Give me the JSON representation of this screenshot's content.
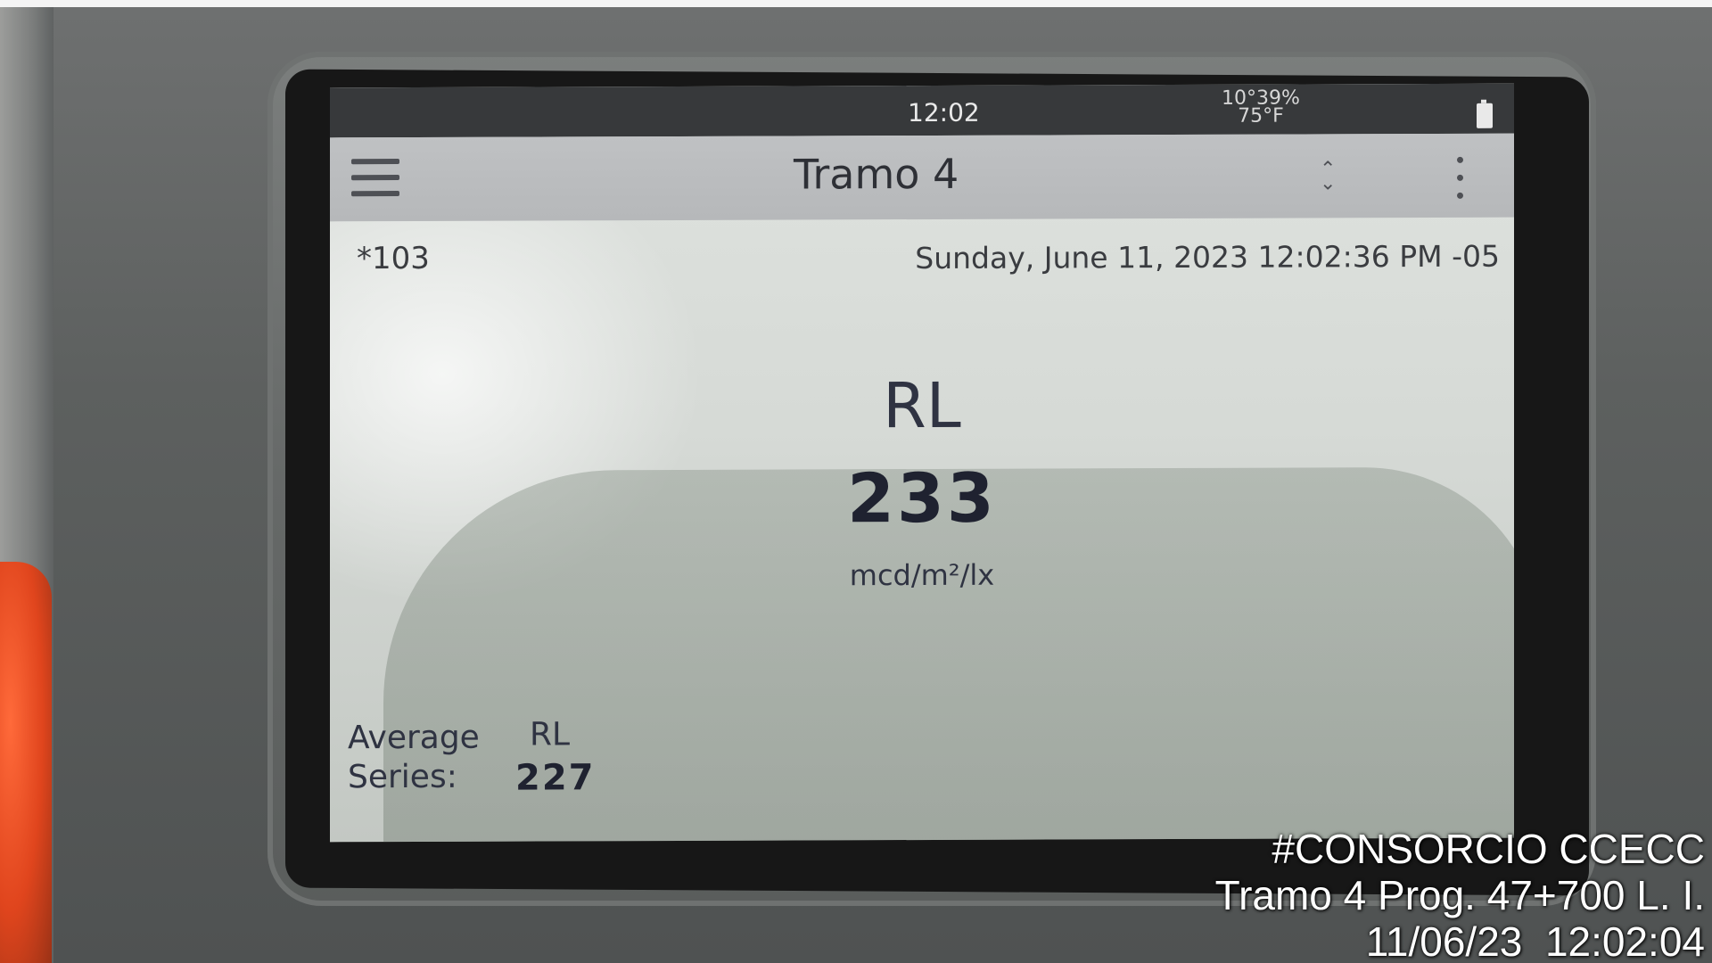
{
  "status_bar": {
    "time": "12:02",
    "environment": "10°39%\n75°F"
  },
  "toolbar": {
    "title": "Tramo 4"
  },
  "header": {
    "record_id": "*103",
    "timestamp": "Sunday, June 11, 2023 12:02:36 PM -05"
  },
  "measurement": {
    "label": "RL",
    "value": "233",
    "unit": "mcd/m²/lx"
  },
  "average": {
    "label_line1": "Average",
    "label_line2": "Series:",
    "metric": "RL",
    "value": "227"
  },
  "photo_overlay": {
    "line1": "#CONSORCIO CCECC",
    "line2": "Tramo 4 Prog. 47+700 L. I.",
    "line3": "11/06/23  12:02:04"
  },
  "icons": {
    "menu": "hamburger-menu-icon",
    "sort": "sort-updown-icon",
    "more": "more-vertical-icon",
    "battery": "battery-icon"
  }
}
